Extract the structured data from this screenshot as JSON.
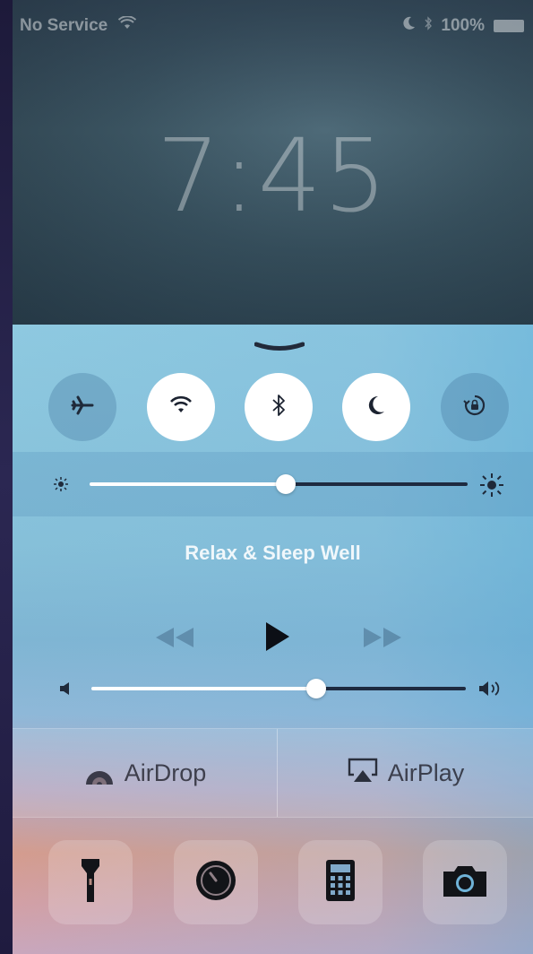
{
  "status_bar": {
    "carrier": "No Service",
    "battery_percent": "100%",
    "icons": [
      "wifi-icon",
      "moon-icon",
      "bluetooth-icon",
      "battery-icon"
    ]
  },
  "lock_screen": {
    "time": "7:45"
  },
  "control_center": {
    "toggles": [
      {
        "name": "airplane-mode",
        "icon": "airplane-icon",
        "state": "off"
      },
      {
        "name": "wifi",
        "icon": "wifi-icon",
        "state": "on"
      },
      {
        "name": "bluetooth",
        "icon": "bluetooth-icon",
        "state": "on"
      },
      {
        "name": "do-not-disturb",
        "icon": "moon-icon",
        "state": "on"
      },
      {
        "name": "rotation-lock",
        "icon": "rotation-lock-icon",
        "state": "off"
      }
    ],
    "brightness_level": 0.52,
    "now_playing": {
      "title": "Relax & Sleep Well",
      "controls": [
        "rewind-icon",
        "play-icon",
        "fast-forward-icon"
      ]
    },
    "volume_level": 0.6,
    "airdrop_label": "AirDrop",
    "airplay_label": "AirPlay",
    "shortcuts": [
      "flashlight-icon",
      "timer-icon",
      "calculator-icon",
      "camera-icon"
    ],
    "colors": {
      "toggle_on": "#ffffff",
      "toggle_off": "#5a8fb5",
      "track_filled": "#ffffff",
      "track_empty": "#1e2a40"
    }
  }
}
